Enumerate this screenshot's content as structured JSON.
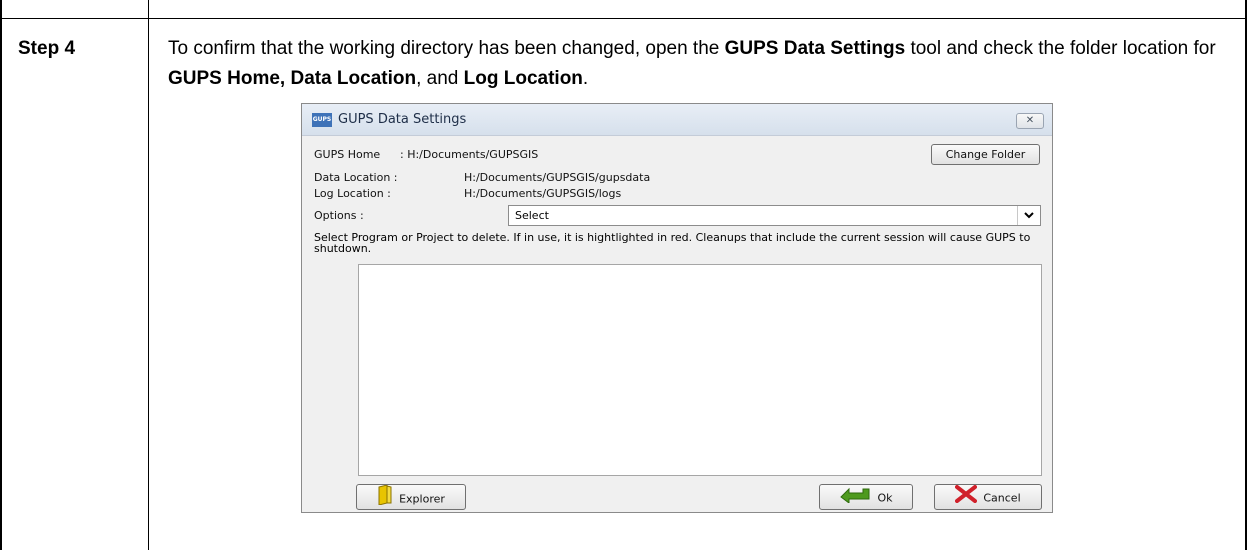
{
  "step": {
    "label": "Step 4"
  },
  "instruction": {
    "part1": "To confirm that the working directory has been changed, open the ",
    "bold1": "GUPS Data Settings",
    "part2": " tool and check the folder location for ",
    "bold2": "GUPS Home, Data Location",
    "part3": ", and ",
    "bold3": "Log Location",
    "part4": "."
  },
  "dialog": {
    "title": "GUPS Data Settings",
    "app_icon_text": "GUPS",
    "close_glyph": "✕",
    "gups_home_label": "GUPS Home",
    "gups_home_value": ": H:/Documents/GUPSGIS",
    "change_folder_label": "Change Folder",
    "data_location_label": "Data Location  :",
    "data_location_value": "H:/Documents/GUPSGIS/gupsdata",
    "log_location_label": "Log Location   :",
    "log_location_value": "H:/Documents/GUPSGIS/logs",
    "options_label": "Options :",
    "options_selected": "Select",
    "hint": "Select Program or Project to delete. If in use, it is hightlighted in red. Cleanups that include the current session will cause GUPS to shutdown.",
    "explorer_label": "Explorer",
    "ok_label": "Ok",
    "cancel_label": "Cancel"
  },
  "icons": {
    "folder": "folder-icon",
    "ok": "green-arrow-icon",
    "cancel": "red-x-icon",
    "dropdown": "chevron-down-icon"
  }
}
